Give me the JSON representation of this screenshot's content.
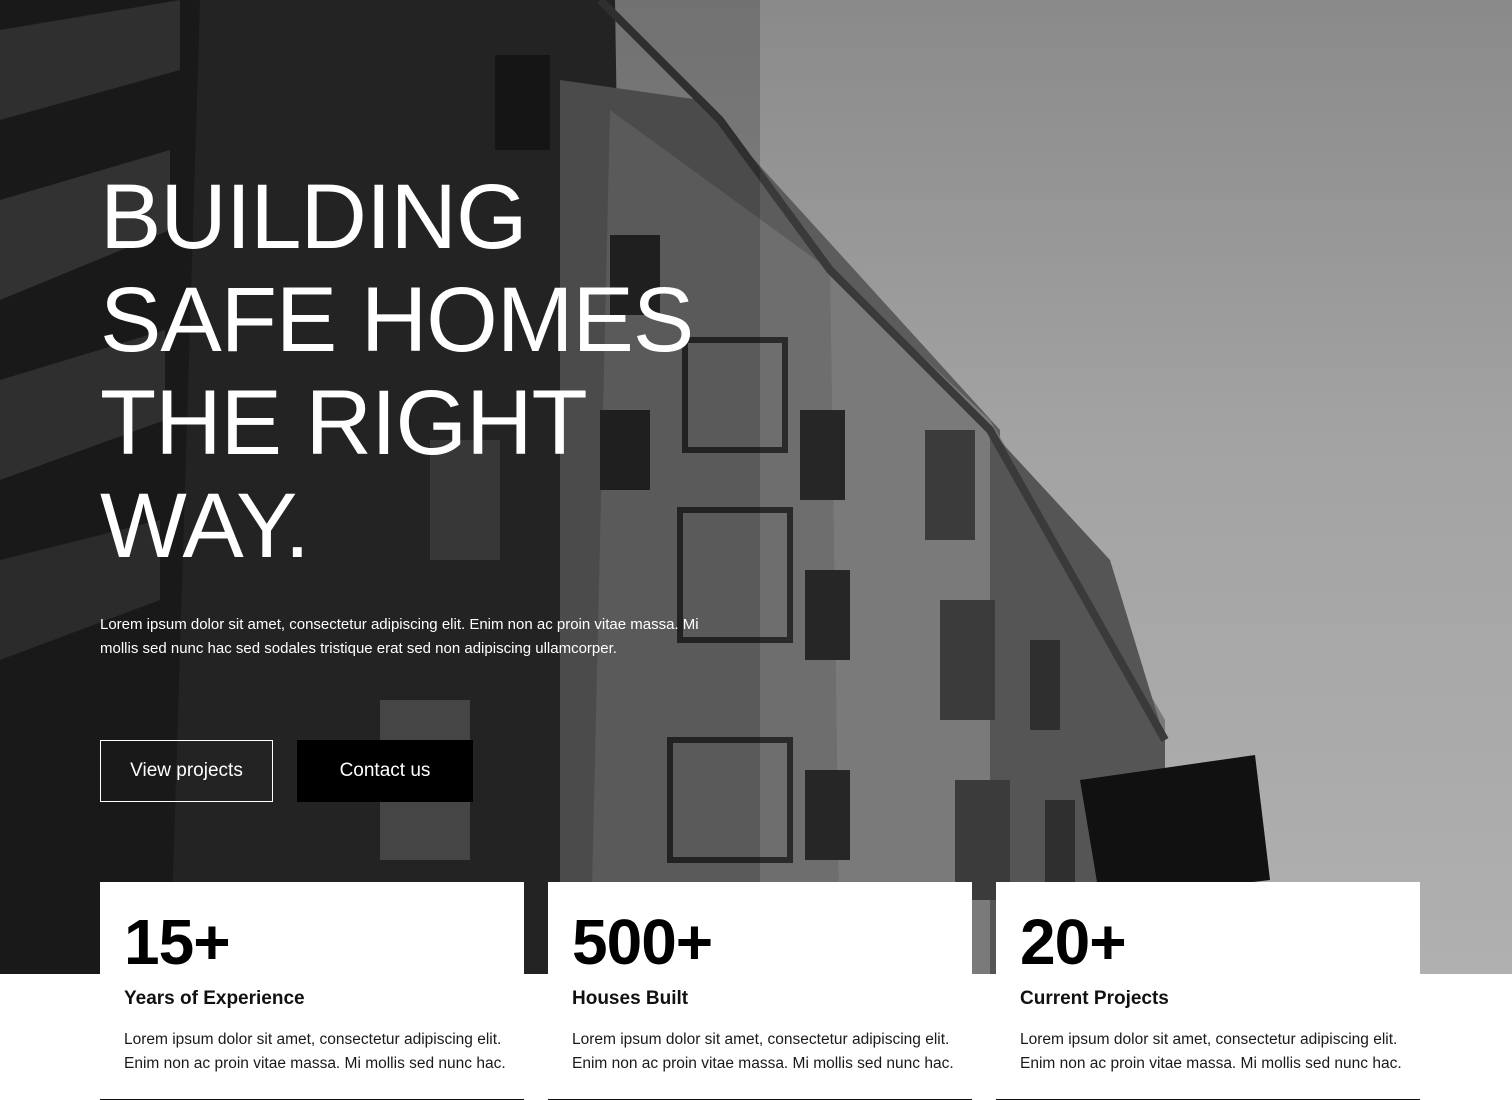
{
  "hero": {
    "headline_lines": [
      "BUILDING",
      "SAFE HOMES",
      "THE RIGHT",
      "WAY."
    ],
    "intro": "Lorem ipsum dolor sit amet, consectetur adipiscing elit. Enim non ac proin vitae massa. Mi mollis sed nunc hac  sed sodales tristique erat sed non adipiscing ullamcorper.",
    "buttons": {
      "view_projects": "View projects",
      "contact_us": "Contact us"
    }
  },
  "stats": [
    {
      "value": "15+",
      "label": "Years of Experience",
      "desc": "Lorem ipsum dolor sit amet, consectetur adipiscing elit. Enim non ac proin vitae massa. Mi mollis sed nunc hac."
    },
    {
      "value": "500+",
      "label": "Houses Built",
      "desc": "Lorem ipsum dolor sit amet, consectetur adipiscing elit. Enim non ac proin vitae massa. Mi mollis sed nunc hac."
    },
    {
      "value": "20+",
      "label": "Current Projects",
      "desc": "Lorem ipsum dolor sit amet, consectetur adipiscing elit. Enim non ac proin vitae massa. Mi mollis sed nunc hac."
    }
  ],
  "colors": {
    "accent": "#000000",
    "text_on_image": "#ffffff",
    "card_bg": "#ffffff"
  }
}
